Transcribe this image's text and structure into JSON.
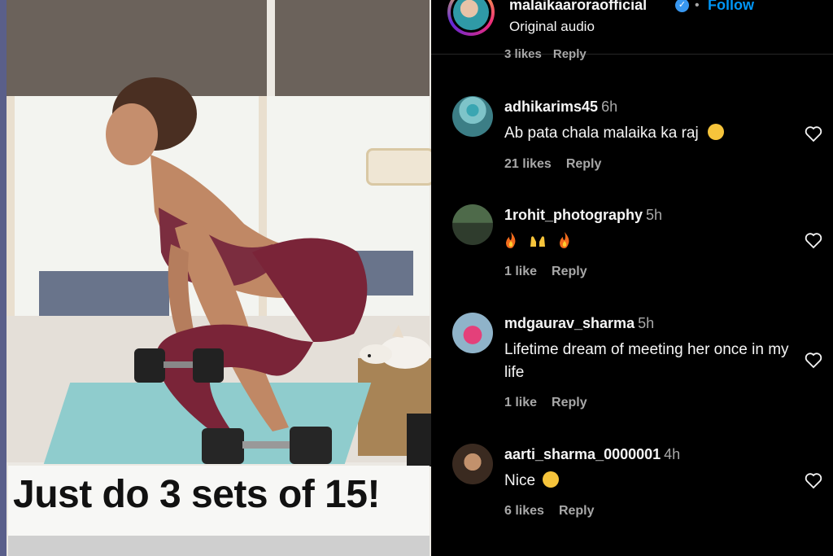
{
  "media": {
    "caption": "Just do 3 sets of 15!"
  },
  "header": {
    "username": "malaikaaroraofficial",
    "separator": "•",
    "follow_label": "Follow",
    "audio_label": "Original audio"
  },
  "previous_comment": {
    "likes": "3 likes",
    "reply": "Reply"
  },
  "comments": [
    {
      "username": "adhikarims45",
      "time": "6h",
      "text": "Ab pata chala malaika ka raj",
      "emoji": "grinning-face-with-sweat-emoji",
      "likes": "21 likes",
      "reply": "Reply"
    },
    {
      "username": "1rohit_photography",
      "time": "5h",
      "text": "",
      "emoji": "fire-emoji raising-hands-emoji fire-emoji",
      "likes": "1 like",
      "reply": "Reply"
    },
    {
      "username": "mdgaurav_sharma",
      "time": "5h",
      "text": "Lifetime dream of meeting her once in my life",
      "likes": "1 like",
      "reply": "Reply"
    },
    {
      "username": "aarti_sharma_0000001",
      "time": "4h",
      "text": "Nice",
      "emoji": "flushed-face-emoji",
      "likes": "6 likes",
      "reply": "Reply"
    }
  ],
  "colors": {
    "background": "#000000",
    "link_blue": "#0095f6",
    "verified_blue": "#3897f0",
    "secondary_text": "#a8a8a8"
  }
}
